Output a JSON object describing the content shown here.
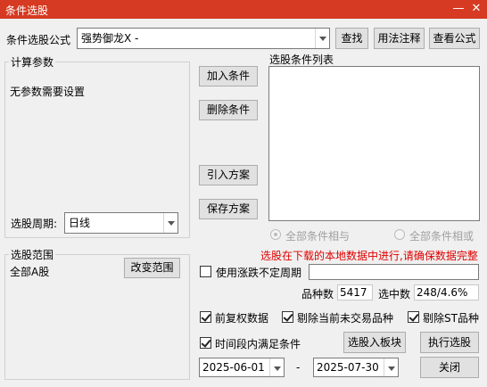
{
  "window": {
    "title": "条件选股",
    "min_icon": "minimize-icon",
    "close_icon": "close-icon",
    "accent": "#d63a22"
  },
  "formula": {
    "label": "条件选股公式",
    "value": "强势御龙X  -",
    "find": "查找",
    "usage": "用法注释",
    "view": "查看公式"
  },
  "params": {
    "legend": "计算参数",
    "note": "无参数需要设置",
    "period_label": "选股周期:",
    "period_value": "日线"
  },
  "condition": {
    "add": "加入条件",
    "delete": "删除条件",
    "import": "引入方案",
    "save": "保存方案",
    "list_label": "选股条件列表",
    "all_and": "全部条件相与",
    "all_or": "全部条件相或"
  },
  "range": {
    "legend": "选股范围",
    "value": "全部A股",
    "change": "改变范围"
  },
  "warning": "选股在下载的本地数据中进行,请确保数据完整",
  "unfixed": {
    "label": "使用涨跌不定周期",
    "checked": false
  },
  "stats": {
    "count_label": "品种数",
    "count_value": "5417",
    "selected_label": "选中数",
    "selected_value": "248/4.6%"
  },
  "options": {
    "pre_adjust": "前复权数据",
    "exclude_untraded": "剔除当前未交易品种",
    "exclude_st": "剔除ST品种",
    "in_period": "时间段内满足条件"
  },
  "actions": {
    "to_block": "选股入板块",
    "execute": "执行选股",
    "close": "关闭"
  },
  "dates": {
    "start": "2025-06-01",
    "sep": "-",
    "end": "2025-07-30"
  }
}
